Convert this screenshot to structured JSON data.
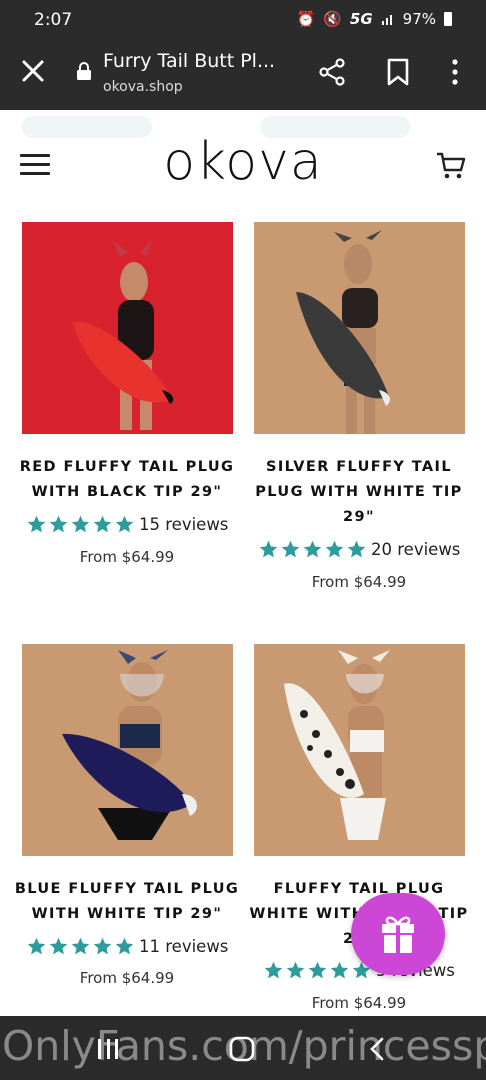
{
  "status_bar": {
    "time": "2:07",
    "network": "5G",
    "battery": "97%"
  },
  "browser": {
    "page_title": "Furry Tail Butt Pl...",
    "domain": "okova.shop"
  },
  "site": {
    "logo": "okova"
  },
  "products": [
    {
      "name_lines": [
        "RED FLUFFY TAIL PLUG",
        "WITH BLACK TIP 29\""
      ],
      "rating": 5,
      "reviews": "15 reviews",
      "price": "From $64.99",
      "image": "red-tail-photo"
    },
    {
      "name_lines": [
        "SILVER FLUFFY TAIL",
        "PLUG WITH WHITE TIP",
        "29\""
      ],
      "rating": 5,
      "reviews": "20 reviews",
      "price": "From $64.99",
      "image": "silver-tail-photo"
    },
    {
      "name_lines": [
        "BLUE FLUFFY TAIL PLUG",
        "WITH WHITE TIP 29\""
      ],
      "rating": 5,
      "reviews": "11 reviews",
      "price": "From $64.99",
      "image": "blue-tail-photo"
    },
    {
      "name_lines": [
        "FLUFFY TAIL PLUG",
        "WHITE WITH BLACK TIP",
        "29\""
      ],
      "rating": 5,
      "reviews": "5 reviews",
      "price": "From $64.99",
      "image": "white-spotted-tail-photo"
    }
  ],
  "watermark": "OnlyFans.com/princesspe",
  "colors": {
    "chrome": "#2b2b2b",
    "star": "#2e9c9c",
    "gift": "#cc47d6",
    "red_backdrop": "#d8222e",
    "tan_backdrop": "#c99a72"
  },
  "icons": [
    "close-icon",
    "lock-icon",
    "share-icon",
    "bookmark-icon",
    "more-icon",
    "menu-icon",
    "cart-icon",
    "star-icon",
    "gift-icon",
    "recent-apps-icon",
    "home-icon",
    "back-icon"
  ]
}
